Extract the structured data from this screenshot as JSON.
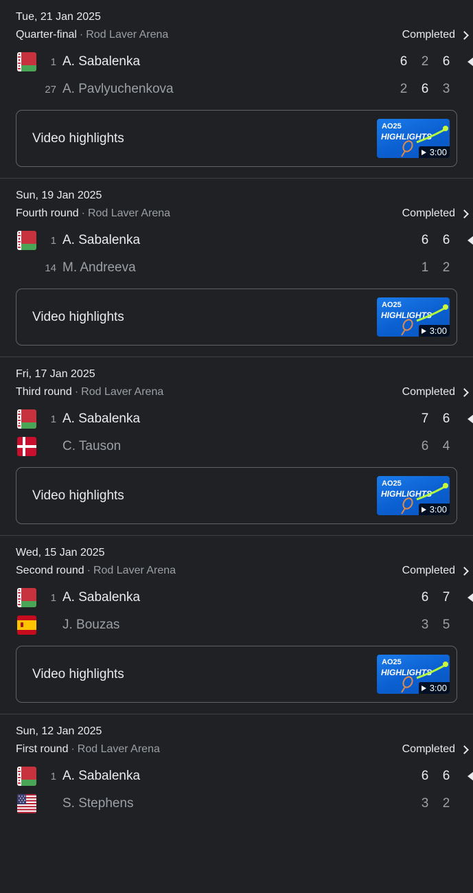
{
  "colors": {
    "background": "#202124",
    "primary_text": "#e8eaed",
    "secondary_text": "#9aa0a6",
    "highlight_thumb": "#1b7bea"
  },
  "video_label": "Video highlights",
  "matches": [
    {
      "date": "Tue, 21 Jan 2025",
      "round": "Quarter-final",
      "venue": "Rod Laver Arena",
      "status": "Completed",
      "video": {
        "label": "Video highlights",
        "thumb_brand": "AO25",
        "thumb_title": "HIGHLIGHTS",
        "duration": "3:00"
      },
      "players": [
        {
          "seed": "1",
          "name": "A. Sabalenka",
          "flag": "belarus-flag",
          "winner": true,
          "scores": [
            "6",
            "2",
            "6"
          ]
        },
        {
          "seed": "27",
          "name": "A. Pavlyuchenkova",
          "flag": "",
          "winner": false,
          "scores": [
            "2",
            "6",
            "3"
          ]
        }
      ]
    },
    {
      "date": "Sun, 19 Jan 2025",
      "round": "Fourth round",
      "venue": "Rod Laver Arena",
      "status": "Completed",
      "video": {
        "label": "Video highlights",
        "thumb_brand": "AO25",
        "thumb_title": "HIGHLIGHTS",
        "duration": "3:00"
      },
      "players": [
        {
          "seed": "1",
          "name": "A. Sabalenka",
          "flag": "belarus-flag",
          "winner": true,
          "scores": [
            "6",
            "6"
          ]
        },
        {
          "seed": "14",
          "name": "M. Andreeva",
          "flag": "",
          "winner": false,
          "scores": [
            "1",
            "2"
          ]
        }
      ]
    },
    {
      "date": "Fri, 17 Jan 2025",
      "round": "Third round",
      "venue": "Rod Laver Arena",
      "status": "Completed",
      "video": {
        "label": "Video highlights",
        "thumb_brand": "AO25",
        "thumb_title": "HIGHLIGHTS",
        "duration": "3:00"
      },
      "players": [
        {
          "seed": "1",
          "name": "A. Sabalenka",
          "flag": "belarus-flag",
          "winner": true,
          "scores": [
            "7",
            "6"
          ]
        },
        {
          "seed": "",
          "name": "C. Tauson",
          "flag": "denmark-flag",
          "winner": false,
          "scores": [
            "6",
            "4"
          ]
        }
      ]
    },
    {
      "date": "Wed, 15 Jan 2025",
      "round": "Second round",
      "venue": "Rod Laver Arena",
      "status": "Completed",
      "video": {
        "label": "Video highlights",
        "thumb_brand": "AO25",
        "thumb_title": "HIGHLIGHTS",
        "duration": "3:00"
      },
      "players": [
        {
          "seed": "1",
          "name": "A. Sabalenka",
          "flag": "belarus-flag",
          "winner": true,
          "scores": [
            "6",
            "7"
          ]
        },
        {
          "seed": "",
          "name": "J. Bouzas",
          "flag": "spain-flag",
          "winner": false,
          "scores": [
            "3",
            "5"
          ]
        }
      ]
    },
    {
      "date": "Sun, 12 Jan 2025",
      "round": "First round",
      "venue": "Rod Laver Arena",
      "status": "Completed",
      "players": [
        {
          "seed": "1",
          "name": "A. Sabalenka",
          "flag": "belarus-flag",
          "winner": true,
          "scores": [
            "6",
            "6"
          ]
        },
        {
          "seed": "",
          "name": "S. Stephens",
          "flag": "usa-flag",
          "winner": false,
          "scores": [
            "3",
            "2"
          ]
        }
      ]
    }
  ]
}
